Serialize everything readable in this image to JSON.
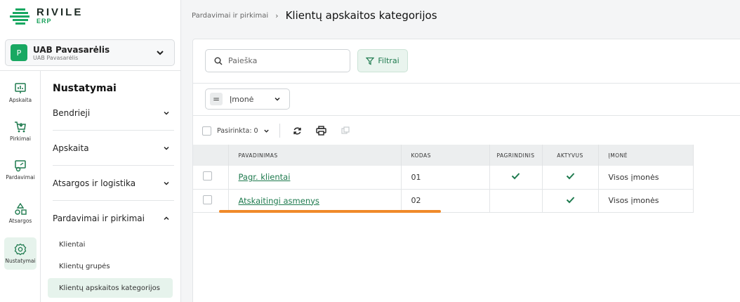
{
  "app": {
    "brand": "RIVILE",
    "brand_sub": "ERP"
  },
  "company": {
    "avatar_letter": "P",
    "name": "UAB Pavasarėlis",
    "sub": "UAB Pavasarėlis"
  },
  "rail": [
    {
      "label": "Apskaita",
      "icon": "chart-board-icon"
    },
    {
      "label": "Pirkimai",
      "icon": "cart-icon"
    },
    {
      "label": "Pardavimai",
      "icon": "sales-icon"
    },
    {
      "label": "Atsargos",
      "icon": "shapes-icon"
    },
    {
      "label": "Nustatymai",
      "icon": "gear-icon",
      "active": true
    }
  ],
  "menu": {
    "title": "Nustatymai",
    "sections": [
      {
        "label": "Bendrieji"
      },
      {
        "label": "Apskaita"
      },
      {
        "label": "Atsargos ir logistika"
      },
      {
        "label": "Pardavimai ir pirkimai",
        "expanded": true
      }
    ],
    "subitems": [
      {
        "label": "Klientai"
      },
      {
        "label": "Klientų grupės"
      },
      {
        "label": "Klientų apskaitos kategorijos",
        "active": true
      }
    ]
  },
  "breadcrumb": {
    "parent": "Pardavimai ir pirkimai",
    "separator": "›",
    "current": "Klientų apskaitos kategorijos"
  },
  "search": {
    "placeholder": "Paieška"
  },
  "filters": {
    "label": "Filtrai"
  },
  "company_filter": {
    "label": "Įmonė"
  },
  "toolbar": {
    "selected_label": "Pasirinkta: 0"
  },
  "table": {
    "columns": [
      "PAVADINIMAS",
      "KODAS",
      "PAGRINDINIS",
      "AKTYVUS",
      "ĮMONĖ"
    ],
    "rows": [
      {
        "name": "Pagr. klientai",
        "code": "01",
        "main": true,
        "active": true,
        "company": "Visos įmonės"
      },
      {
        "name": "Atskaitingi asmenys",
        "code": "02",
        "main": false,
        "active": true,
        "company": "Visos įmonės"
      }
    ]
  },
  "colors": {
    "accent": "#1e7a4e",
    "brand_green": "#19a862",
    "highlight": "#f08a2a"
  }
}
